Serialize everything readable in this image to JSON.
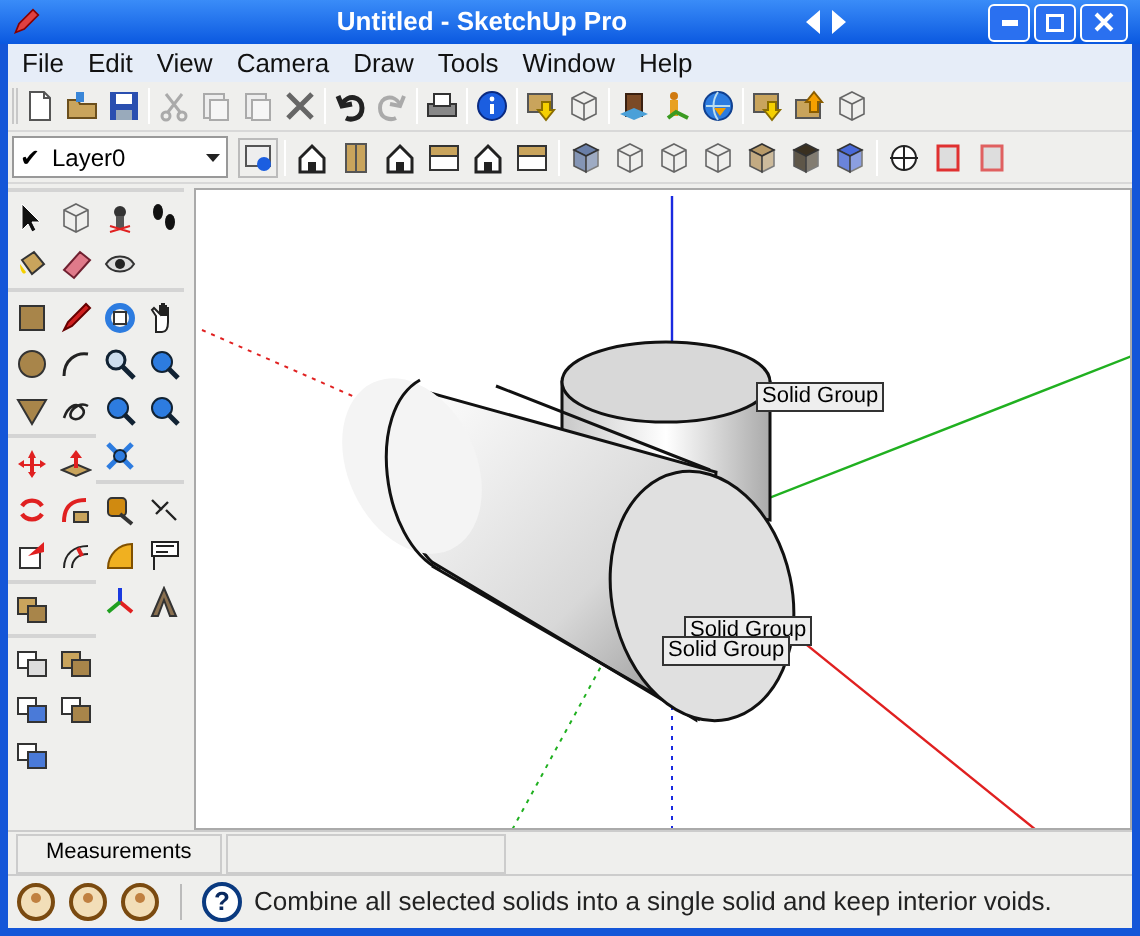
{
  "window": {
    "title": "Untitled - SketchUp Pro"
  },
  "menu": [
    "File",
    "Edit",
    "View",
    "Camera",
    "Draw",
    "Tools",
    "Window",
    "Help"
  ],
  "layer_select": {
    "check": "✔",
    "value": "Layer0"
  },
  "canvas": {
    "labels": [
      "Solid Group",
      "Solid Group",
      "Solid Group"
    ]
  },
  "measurements": {
    "label": "Measurements"
  },
  "status_bar": {
    "help": "?",
    "message": "Combine all selected solids into a single solid and keep interior voids."
  }
}
